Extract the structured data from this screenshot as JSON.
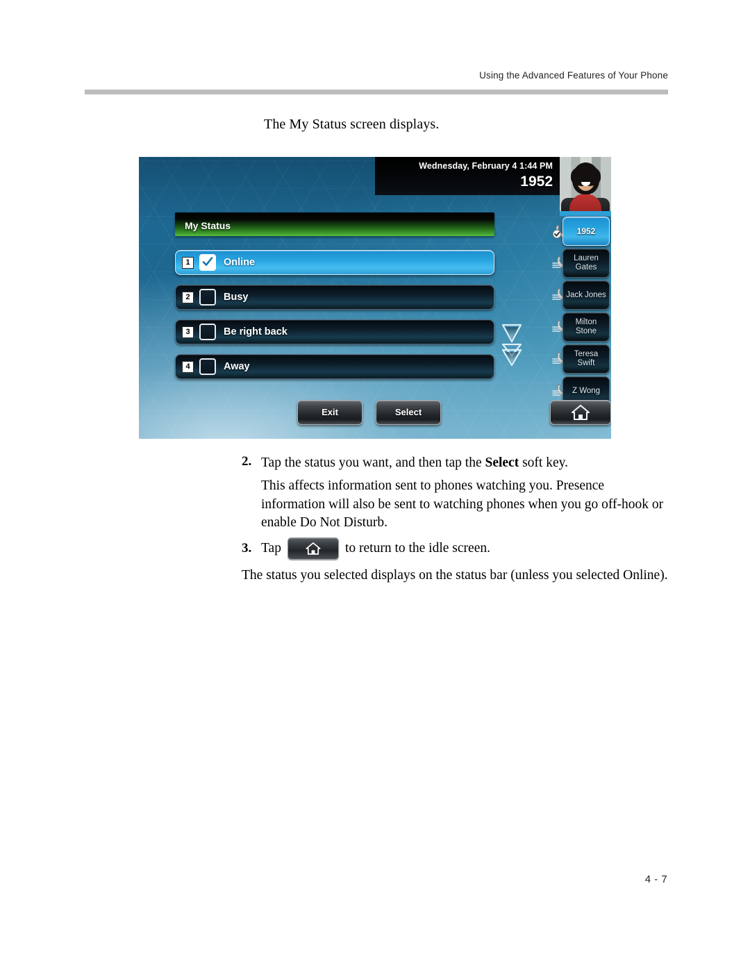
{
  "header": {
    "title": "Using the Advanced Features of Your Phone"
  },
  "intro": "The My Status screen displays.",
  "steps": {
    "two": {
      "number": "2.",
      "text_before": "Tap the status you want, and then tap the ",
      "bold": "Select",
      "text_after": " soft key.",
      "paragraph": "This affects information sent to phones watching you. Presence information will also be sent to watching phones when you go off-hook or enable Do Not Disturb."
    },
    "three": {
      "number": "3.",
      "text_before": "Tap",
      "text_after": "to return to the idle screen."
    }
  },
  "closing": "The status you selected displays on the status bar (unless you selected Online).",
  "page_number": "4 - 7",
  "phone": {
    "statusbar": {
      "datetime": "Wednesday, February 4  1:44 PM",
      "extension": "1952"
    },
    "title": "My Status",
    "status_rows": [
      {
        "index": "1",
        "label": "Online",
        "checked": true,
        "selected": true
      },
      {
        "index": "2",
        "label": "Busy",
        "checked": false,
        "selected": false
      },
      {
        "index": "3",
        "label": "Be right back",
        "checked": false,
        "selected": false
      },
      {
        "index": "4",
        "label": "Away",
        "checked": false,
        "selected": false
      }
    ],
    "sidebar": [
      {
        "label": "1952",
        "selected": true
      },
      {
        "label": "Lauren Gates",
        "selected": false
      },
      {
        "label": "Jack Jones",
        "selected": false
      },
      {
        "label": "Milton Stone",
        "selected": false
      },
      {
        "label": "Teresa Swift",
        "selected": false
      },
      {
        "label": "Z Wong",
        "selected": false
      }
    ],
    "softkeys": {
      "exit": "Exit",
      "select": "Select"
    },
    "colors": {
      "selected_blue": "#27a3e0",
      "title_green": "#3f9a2c",
      "background_blue": "#2b7ca4"
    }
  }
}
